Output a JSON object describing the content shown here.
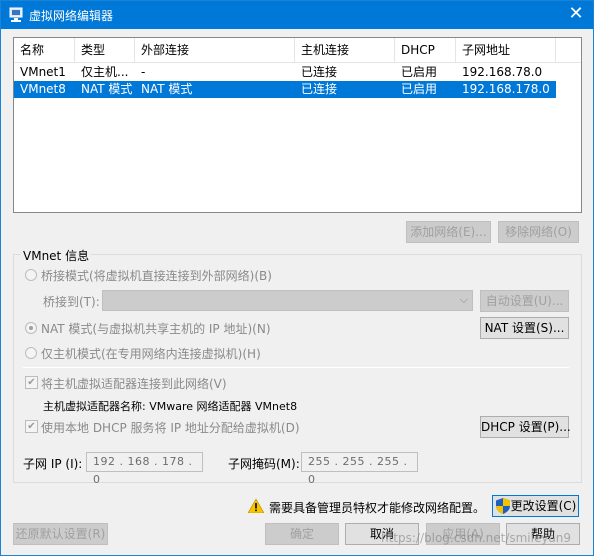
{
  "window": {
    "title": "虚拟网络编辑器",
    "close_glyph": "✕"
  },
  "table": {
    "columns": [
      "名称",
      "类型",
      "外部连接",
      "主机连接",
      "DHCP",
      "子网地址"
    ],
    "rows": [
      {
        "name": "VMnet1",
        "type": "仅主机...",
        "external": "-",
        "host": "已连接",
        "dhcp": "已启用",
        "subnet": "192.168.78.0",
        "selected": false
      },
      {
        "name": "VMnet8",
        "type": "NAT 模式",
        "external": "NAT 模式",
        "host": "已连接",
        "dhcp": "已启用",
        "subnet": "192.168.178.0",
        "selected": true
      }
    ]
  },
  "buttons": {
    "add_network": "添加网络(E)...",
    "remove_network": "移除网络(O)",
    "auto_settings": "自动设置(U)...",
    "nat_settings": "NAT 设置(S)...",
    "dhcp_settings": "DHCP 设置(P)...",
    "change_settings": "更改设置(C)",
    "restore_defaults": "还原默认设置(R)",
    "ok": "确定",
    "cancel": "取消",
    "apply": "应用(A)",
    "help": "帮助"
  },
  "vmnet_info": {
    "group_title": "VMnet 信息",
    "bridged_label": "桥接模式(将虚拟机直接连接到外部网络)(B)",
    "bridged_to_label": "桥接到(T):",
    "bridged_to_value": "",
    "nat_label": "NAT 模式(与虚拟机共享主机的 IP 地址)(N)",
    "host_only_label": "仅主机模式(在专用网络内连接虚拟机)(H)",
    "selected_mode": "nat",
    "connect_adapter_label": "将主机虚拟适配器连接到此网络(V)",
    "connect_adapter_checked": true,
    "adapter_name_label": "主机虚拟适配器名称: VMware 网络适配器 VMnet8",
    "use_dhcp_label": "使用本地 DHCP 服务将 IP 地址分配给虚拟机(D)",
    "use_dhcp_checked": true,
    "subnet_ip_label": "子网 IP (I):",
    "subnet_ip_value": "192 . 168 . 178 . 0",
    "subnet_mask_label": "子网掩码(M):",
    "subnet_mask_value": "255 . 255 . 255 . 0"
  },
  "admin_notice": "需要具备管理员特权才能修改网络配置。",
  "watermark": "https://blog.csdn.net/smileyan9",
  "colors": {
    "title_bar": "#0078d7",
    "selection": "#0078d7",
    "window_bg": "#f0f0f0"
  },
  "icons": {
    "app": "network-editor-icon",
    "warning": "warning-icon",
    "shield": "uac-shield-icon"
  }
}
